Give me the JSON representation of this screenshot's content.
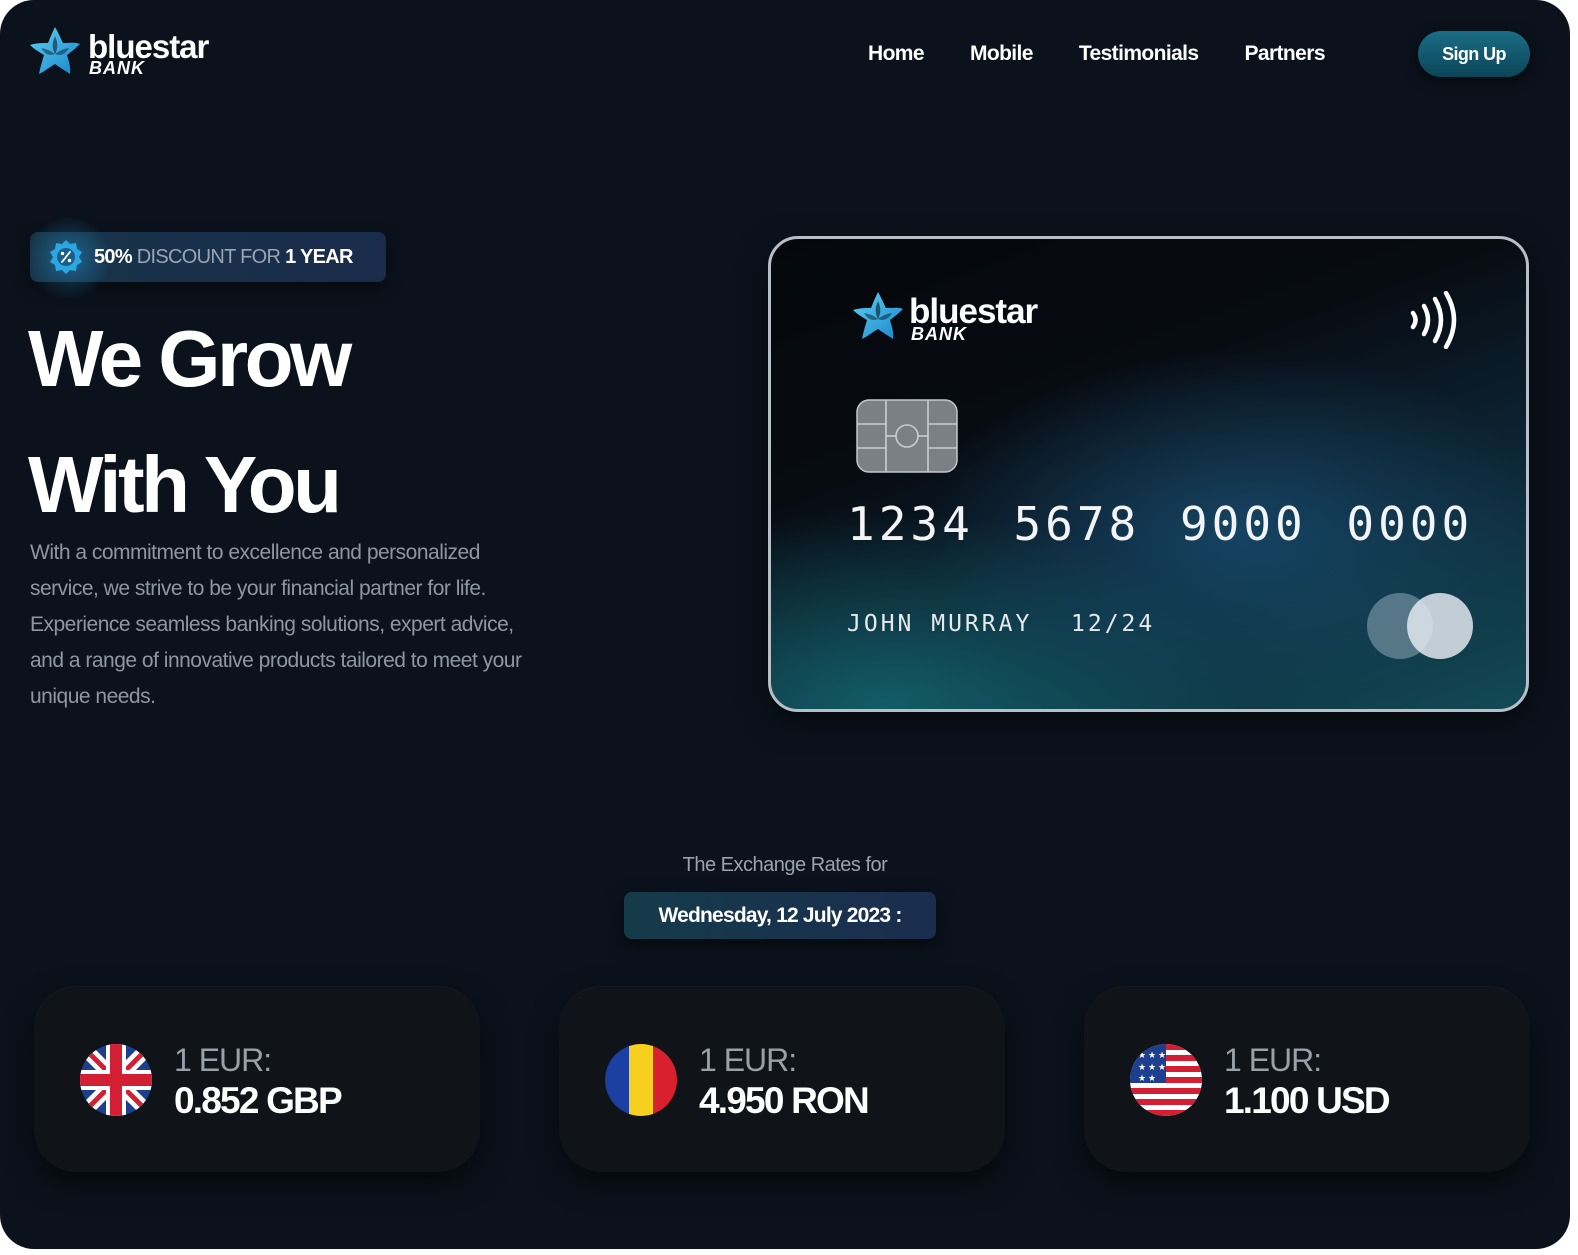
{
  "brand": {
    "name": "bluestar",
    "sub": "BANK",
    "accent": "#1fa9e0"
  },
  "nav": {
    "items": [
      "Home",
      "Mobile",
      "Testimonials",
      "Partners"
    ],
    "signup_label": "Sign Up"
  },
  "hero": {
    "badge": {
      "percent": "50%",
      "middle": " DISCOUNT FOR ",
      "duration": "1 YEAR"
    },
    "title_line1": "We Grow",
    "title_line2": "With You",
    "description": "With a commitment to excellence and personalized service, we strive to be your financial partner for life. Experience seamless banking solutions, expert advice, and a range of innovative products tailored to meet your unique needs."
  },
  "card": {
    "number": "1234 5678 9000 0000",
    "holder": "JOHN MURRAY",
    "expiry": "12/24",
    "icons": [
      "contactless-icon",
      "chip-icon",
      "mastercard-logo"
    ]
  },
  "exchange": {
    "label": "The Exchange Rates for",
    "date": "Wednesday, 12 July 2023 :",
    "rates": [
      {
        "unit": "1 EUR:",
        "value": "0.852 GBP",
        "flag": "uk-flag-icon"
      },
      {
        "unit": "1 EUR:",
        "value": "4.950 RON",
        "flag": "romania-flag-icon"
      },
      {
        "unit": "1 EUR:",
        "value": "1.100 USD",
        "flag": "usa-flag-icon"
      }
    ]
  }
}
